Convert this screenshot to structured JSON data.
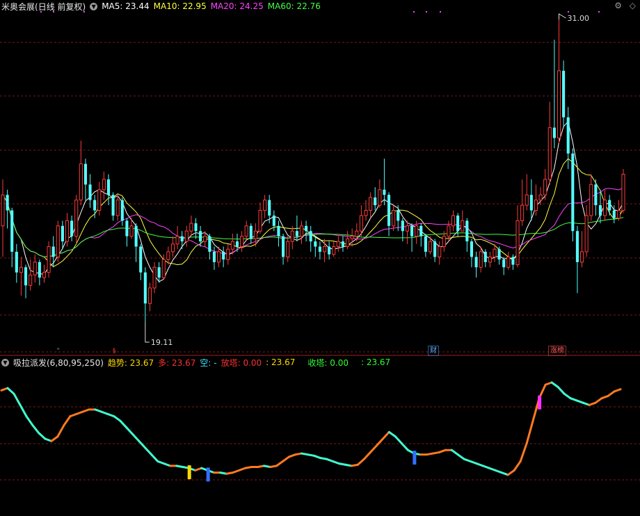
{
  "main": {
    "stock_name": "米奥会展",
    "period": "(日线 前复权)",
    "ma": [
      {
        "key": "ma5",
        "label": "MA5:",
        "value": "23.44"
      },
      {
        "key": "ma10",
        "label": "MA10:",
        "value": "22.95"
      },
      {
        "key": "ma20",
        "label": "MA20:",
        "value": "24.25"
      },
      {
        "key": "ma60",
        "label": "MA60:",
        "value": "22.76"
      }
    ],
    "high_label": "31.00",
    "low_label": "19.11",
    "tags": {
      "cai": "财",
      "zhangbang": "涨榜"
    },
    "corner_icons": [
      "settings-icon",
      "diamond-icon"
    ]
  },
  "indicator": {
    "name": "吸拉派发(6,80,95,250)",
    "trend_label": "趋势:",
    "trend_value": "23.67",
    "duo_label": "多:",
    "duo_value": "23.67",
    "kong_label": "空:",
    "kong_value": "-",
    "fangta_label": "放塔:",
    "fangta_value": "0.00",
    "sep_value": ": 23.67",
    "shouta_label": "收塔:",
    "shouta_value": "0.00",
    "last_value": ": 23.67"
  },
  "colors": {
    "up": "#ff3a3a",
    "down": "#54ffff",
    "ma5": "#ffffff",
    "ma10": "#ffff44",
    "ma20": "#ff44ff",
    "ma60": "#44ff44",
    "grid": "#7a1a1a"
  },
  "chart_data": {
    "type": "candlestick",
    "ylim": [
      19.11,
      31.0
    ],
    "candles": [
      [
        22.8,
        24.0,
        24.6,
        21.6
      ],
      [
        24.0,
        23.4,
        24.2,
        22.7
      ],
      [
        23.4,
        21.8,
        23.5,
        21.2
      ],
      [
        21.8,
        21.0,
        22.1,
        20.6
      ],
      [
        21.0,
        21.2,
        21.6,
        20.1
      ],
      [
        21.2,
        20.5,
        21.3,
        20.0
      ],
      [
        20.5,
        20.9,
        21.5,
        20.3
      ],
      [
        20.9,
        21.4,
        21.7,
        20.6
      ],
      [
        21.4,
        20.8,
        21.5,
        20.5
      ],
      [
        20.8,
        21.0,
        21.3,
        20.6
      ],
      [
        21.0,
        22.0,
        22.2,
        20.8
      ],
      [
        22.0,
        21.6,
        22.4,
        21.2
      ],
      [
        21.6,
        22.8,
        23.0,
        21.4
      ],
      [
        22.8,
        22.2,
        23.0,
        21.9
      ],
      [
        22.2,
        23.0,
        23.3,
        22.0
      ],
      [
        23.0,
        22.4,
        23.2,
        22.2
      ],
      [
        22.4,
        23.8,
        24.0,
        22.1
      ],
      [
        23.8,
        25.2,
        26.1,
        23.6
      ],
      [
        25.2,
        24.4,
        25.4,
        23.8
      ],
      [
        24.4,
        23.8,
        24.8,
        23.5
      ],
      [
        23.8,
        23.4,
        24.0,
        23.1
      ],
      [
        23.4,
        24.2,
        24.5,
        23.2
      ],
      [
        24.2,
        24.6,
        24.9,
        23.8
      ],
      [
        24.6,
        24.0,
        24.8,
        23.6
      ],
      [
        24.0,
        23.2,
        24.1,
        23.0
      ],
      [
        23.2,
        23.8,
        24.0,
        23.0
      ],
      [
        23.8,
        23.0,
        23.9,
        22.8
      ],
      [
        23.0,
        22.4,
        23.1,
        22.0
      ],
      [
        22.4,
        22.8,
        23.1,
        22.3
      ],
      [
        22.8,
        22.0,
        22.9,
        21.4
      ],
      [
        22.0,
        21.0,
        22.1,
        20.7
      ],
      [
        21.0,
        19.8,
        21.2,
        19.11
      ],
      [
        19.8,
        20.4,
        20.6,
        19.5
      ],
      [
        20.4,
        21.2,
        21.4,
        20.2
      ],
      [
        21.2,
        20.8,
        21.4,
        20.6
      ],
      [
        20.8,
        21.5,
        21.7,
        20.7
      ],
      [
        21.5,
        21.8,
        22.0,
        21.3
      ],
      [
        21.8,
        22.1,
        22.4,
        21.6
      ],
      [
        22.1,
        22.4,
        22.8,
        21.9
      ],
      [
        22.4,
        22.2,
        22.6,
        21.9
      ],
      [
        22.2,
        22.6,
        22.8,
        22.0
      ],
      [
        22.6,
        22.9,
        23.2,
        22.4
      ],
      [
        22.9,
        22.6,
        23.1,
        22.3
      ],
      [
        22.6,
        22.2,
        22.8,
        22.0
      ],
      [
        22.2,
        22.4,
        22.6,
        22.0
      ],
      [
        22.4,
        21.8,
        22.5,
        21.5
      ],
      [
        21.8,
        21.4,
        22.0,
        21.1
      ],
      [
        21.4,
        21.8,
        22.0,
        21.2
      ],
      [
        21.8,
        21.5,
        22.0,
        21.2
      ],
      [
        21.5,
        21.9,
        22.1,
        21.3
      ],
      [
        21.9,
        22.2,
        22.5,
        21.7
      ],
      [
        22.2,
        22.0,
        22.5,
        21.8
      ],
      [
        22.0,
        22.4,
        22.6,
        21.8
      ],
      [
        22.4,
        22.8,
        23.0,
        22.2
      ],
      [
        22.8,
        22.3,
        22.9,
        22.1
      ],
      [
        22.3,
        22.6,
        22.9,
        22.0
      ],
      [
        22.6,
        23.4,
        23.7,
        22.5
      ],
      [
        23.4,
        23.8,
        24.0,
        23.1
      ],
      [
        23.8,
        23.2,
        24.0,
        22.9
      ],
      [
        23.2,
        22.8,
        23.4,
        22.6
      ],
      [
        22.8,
        22.4,
        23.0,
        22.0
      ],
      [
        22.4,
        21.6,
        22.5,
        21.3
      ],
      [
        21.6,
        22.2,
        22.4,
        21.4
      ],
      [
        22.2,
        22.6,
        22.8,
        21.9
      ],
      [
        22.6,
        22.4,
        23.2,
        22.2
      ],
      [
        22.4,
        22.8,
        23.0,
        22.1
      ],
      [
        22.8,
        22.6,
        23.0,
        22.2
      ],
      [
        22.6,
        22.2,
        22.8,
        21.8
      ],
      [
        22.2,
        22.0,
        22.4,
        21.6
      ],
      [
        22.0,
        21.8,
        22.2,
        21.5
      ],
      [
        21.8,
        22.0,
        22.3,
        21.4
      ],
      [
        22.0,
        21.7,
        22.2,
        21.5
      ],
      [
        21.7,
        22.0,
        22.2,
        21.6
      ],
      [
        22.0,
        22.2,
        22.4,
        21.8
      ],
      [
        22.2,
        22.0,
        22.4,
        21.8
      ],
      [
        22.0,
        22.3,
        22.6,
        21.9
      ],
      [
        22.3,
        22.4,
        22.7,
        22.0
      ],
      [
        22.4,
        22.6,
        22.9,
        22.2
      ],
      [
        22.6,
        23.2,
        23.6,
        22.4
      ],
      [
        23.2,
        23.4,
        23.8,
        23.0
      ],
      [
        23.4,
        23.9,
        24.1,
        23.1
      ],
      [
        23.9,
        23.6,
        24.3,
        23.4
      ],
      [
        23.6,
        24.2,
        24.6,
        23.5
      ],
      [
        24.2,
        24.0,
        25.4,
        23.6
      ],
      [
        24.0,
        22.8,
        24.1,
        22.4
      ],
      [
        22.8,
        23.4,
        23.6,
        22.6
      ],
      [
        23.4,
        23.0,
        23.6,
        22.6
      ],
      [
        23.0,
        22.6,
        23.1,
        22.2
      ],
      [
        22.6,
        22.8,
        23.0,
        22.1
      ],
      [
        22.8,
        22.4,
        22.9,
        21.8
      ],
      [
        22.4,
        22.8,
        23.0,
        22.1
      ],
      [
        22.8,
        22.4,
        22.9,
        22.0
      ],
      [
        22.4,
        21.8,
        22.5,
        21.6
      ],
      [
        21.8,
        22.2,
        22.4,
        21.7
      ],
      [
        22.2,
        21.6,
        22.3,
        21.4
      ],
      [
        21.6,
        22.0,
        22.2,
        21.3
      ],
      [
        22.0,
        22.4,
        22.6,
        21.8
      ],
      [
        22.4,
        22.8,
        23.0,
        22.2
      ],
      [
        22.8,
        23.2,
        23.4,
        22.6
      ],
      [
        23.2,
        22.6,
        23.3,
        22.4
      ],
      [
        22.6,
        23.0,
        23.4,
        22.6
      ],
      [
        23.0,
        22.2,
        23.1,
        21.8
      ],
      [
        22.2,
        21.6,
        22.3,
        21.2
      ],
      [
        21.6,
        21.2,
        21.8,
        20.8
      ],
      [
        21.2,
        21.8,
        22.0,
        21.0
      ],
      [
        21.8,
        21.4,
        21.9,
        21.2
      ],
      [
        21.4,
        21.6,
        21.8,
        21.2
      ],
      [
        21.6,
        21.9,
        22.1,
        21.4
      ],
      [
        21.9,
        21.5,
        22.0,
        21.3
      ],
      [
        21.5,
        21.2,
        21.6,
        20.9
      ],
      [
        21.2,
        21.6,
        21.8,
        21.1
      ],
      [
        21.6,
        21.3,
        21.7,
        21.1
      ],
      [
        21.3,
        23.0,
        23.6,
        21.2
      ],
      [
        23.0,
        23.6,
        24.6,
        22.8
      ],
      [
        23.6,
        24.0,
        24.8,
        23.4
      ],
      [
        24.0,
        23.4,
        24.6,
        23.0
      ],
      [
        23.4,
        23.8,
        24.4,
        23.2
      ],
      [
        23.8,
        24.0,
        24.3,
        23.6
      ],
      [
        24.0,
        24.6,
        25.0,
        23.8
      ],
      [
        24.6,
        26.6,
        27.6,
        24.4
      ],
      [
        26.6,
        26.2,
        30.0,
        25.8
      ],
      [
        26.2,
        28.8,
        31.0,
        26.0
      ],
      [
        28.8,
        27.0,
        29.2,
        26.6
      ],
      [
        27.0,
        25.6,
        27.4,
        25.0
      ],
      [
        25.6,
        22.6,
        25.8,
        22.2
      ],
      [
        22.6,
        21.4,
        22.8,
        20.2
      ],
      [
        21.4,
        21.8,
        22.6,
        21.2
      ],
      [
        21.8,
        23.2,
        23.6,
        21.6
      ],
      [
        23.2,
        24.4,
        24.8,
        23.0
      ],
      [
        24.4,
        23.6,
        24.6,
        23.2
      ],
      [
        23.6,
        23.2,
        24.2,
        22.9
      ],
      [
        23.2,
        23.8,
        24.2,
        23.0
      ],
      [
        23.8,
        23.4,
        24.0,
        23.2
      ],
      [
        23.4,
        23.1,
        23.6,
        22.9
      ],
      [
        23.1,
        23.4,
        23.8,
        23.0
      ],
      [
        23.4,
        24.8,
        25.0,
        23.3
      ]
    ],
    "indicator_series": [
      0.93,
      0.95,
      0.9,
      0.8,
      0.7,
      0.62,
      0.55,
      0.5,
      0.48,
      0.52,
      0.62,
      0.7,
      0.72,
      0.74,
      0.76,
      0.76,
      0.74,
      0.72,
      0.7,
      0.66,
      0.6,
      0.54,
      0.48,
      0.42,
      0.36,
      0.3,
      0.28,
      0.26,
      0.26,
      0.25,
      0.24,
      0.22,
      0.24,
      0.22,
      0.2,
      0.2,
      0.19,
      0.2,
      0.22,
      0.24,
      0.25,
      0.25,
      0.26,
      0.25,
      0.26,
      0.3,
      0.34,
      0.36,
      0.37,
      0.36,
      0.35,
      0.33,
      0.32,
      0.3,
      0.28,
      0.27,
      0.26,
      0.27,
      0.32,
      0.38,
      0.44,
      0.5,
      0.56,
      0.52,
      0.46,
      0.4,
      0.37,
      0.36,
      0.36,
      0.37,
      0.38,
      0.4,
      0.4,
      0.36,
      0.32,
      0.3,
      0.28,
      0.26,
      0.24,
      0.22,
      0.2,
      0.18,
      0.22,
      0.3,
      0.46,
      0.66,
      0.86,
      0.98,
      1.0,
      0.96,
      0.9,
      0.86,
      0.84,
      0.82,
      0.8,
      0.82,
      0.86,
      0.88,
      0.92,
      0.94
    ]
  }
}
